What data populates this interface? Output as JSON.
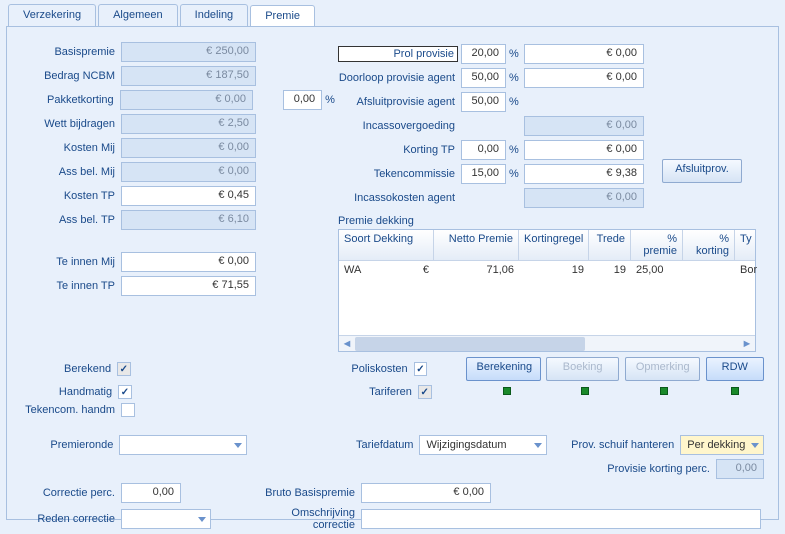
{
  "tabs": [
    "Verzekering",
    "Algemeen",
    "Indeling",
    "Premie"
  ],
  "active_tab": 3,
  "left": {
    "basispremie": {
      "label": "Basispremie",
      "val": "€ 250,00"
    },
    "bedrag_ncbm": {
      "label": "Bedrag NCBM",
      "val": "€ 187,50"
    },
    "pakketkorting": {
      "label": "Pakketkorting",
      "val": "€ 0,00",
      "extra": "0,00",
      "pct": "%"
    },
    "wett": {
      "label": "Wett bijdragen",
      "val": "€ 2,50"
    },
    "kosten_mij": {
      "label": "Kosten Mij",
      "val": "€ 0,00"
    },
    "ass_bel_mij": {
      "label": "Ass bel. Mij",
      "val": "€ 0,00"
    },
    "kosten_tp": {
      "label": "Kosten TP",
      "val": "€ 0,45"
    },
    "ass_bel_tp": {
      "label": "Ass bel. TP",
      "val": "€ 6,10"
    },
    "te_innen_mij": {
      "label": "Te innen Mij",
      "val": "€ 0,00"
    },
    "te_innen_tp": {
      "label": "Te innen TP",
      "val": "€ 71,55"
    }
  },
  "mid": {
    "prol": {
      "label": "Prol provisie",
      "val": "20,00",
      "pct": "%",
      "amt": "€ 0,00"
    },
    "doorloop": {
      "label": "Doorloop provisie agent",
      "val": "50,00",
      "pct": "%",
      "amt": "€ 0,00"
    },
    "afsluit": {
      "label": "Afsluitprovisie agent",
      "val": "50,00",
      "pct": "%"
    },
    "incasso_verg": {
      "label": "Incassovergoeding",
      "amt": "€ 0,00"
    },
    "korting_tp": {
      "label": "Korting TP",
      "val": "0,00",
      "pct": "%",
      "amt": "€ 0,00"
    },
    "tekencommissie": {
      "label": "Tekencommissie",
      "val": "15,00",
      "pct": "%",
      "amt": "€ 9,38"
    },
    "incassokosten": {
      "label": "Incassokosten agent",
      "amt": "€ 0,00"
    }
  },
  "afsluitprov_btn": "Afsluitprov.",
  "table": {
    "title": "Premie dekking",
    "headers": [
      "Soort Dekking",
      "Netto Premie",
      "Kortingregel",
      "Trede",
      "% premie",
      "% korting",
      "Ty"
    ],
    "row": {
      "soort": "WA",
      "cur": "€",
      "netto": "71,06",
      "kort": "19",
      "trede": "19",
      "pct_premie": "25,00",
      "pct_korting": "",
      "ty": "Bor"
    }
  },
  "checks": {
    "berekend": {
      "label": "Berekend",
      "on": true,
      "dis": true
    },
    "handmatig": {
      "label": "Handmatig",
      "on": true,
      "dis": false
    },
    "tekencom": {
      "label": "Tekencom. handm",
      "on": false,
      "dis": false
    },
    "poliskosten": {
      "label": "Poliskosten",
      "on": true,
      "dis": false
    },
    "tariferen": {
      "label": "Tariferen",
      "on": true,
      "dis": true
    }
  },
  "buttons": {
    "berekening": "Berekening",
    "boeking": "Boeking",
    "opmerking": "Opmerking",
    "rdw": "RDW"
  },
  "dropdowns": {
    "premieronde": {
      "label": "Premieronde",
      "val": ""
    },
    "tariefdatum": {
      "label": "Tariefdatum",
      "val": "Wijzigingsdatum"
    },
    "prov_schuif": {
      "label": "Prov. schuif hanteren",
      "val": "Per dekking"
    },
    "prov_korting": {
      "label": "Provisie korting perc.",
      "val": "0,00"
    }
  },
  "bottom": {
    "correctie_perc": {
      "label": "Correctie perc.",
      "val": "0,00"
    },
    "reden": {
      "label": "Reden correctie",
      "val": ""
    },
    "bruto": {
      "label": "Bruto Basispremie",
      "val": "€ 0,00"
    },
    "omschr": {
      "label": "Omschrijving correctie",
      "val": ""
    }
  }
}
